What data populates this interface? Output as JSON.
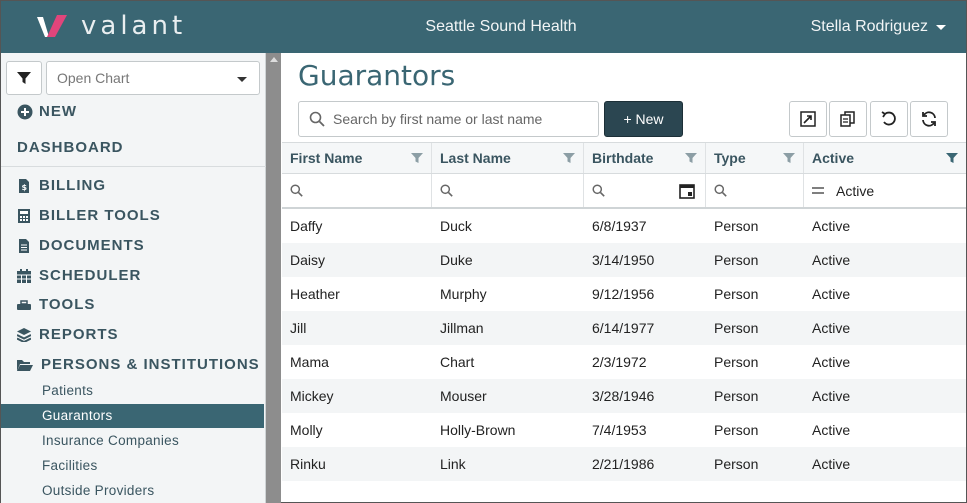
{
  "app": {
    "logo_text": "valant",
    "title": "Seattle Sound Health",
    "user": "Stella Rodriguez"
  },
  "sidebar": {
    "open_chart_placeholder": "Open Chart",
    "new_label": "NEW",
    "dashboard_label": "DASHBOARD",
    "items": [
      {
        "label": "BILLING",
        "icon": "file-dollar-icon"
      },
      {
        "label": "BILLER TOOLS",
        "icon": "calculator-icon"
      },
      {
        "label": "DOCUMENTS",
        "icon": "document-icon"
      },
      {
        "label": "SCHEDULER",
        "icon": "calendar-icon"
      },
      {
        "label": "TOOLS",
        "icon": "wrench-icon"
      },
      {
        "label": "REPORTS",
        "icon": "layers-icon"
      },
      {
        "label": "PERSONS & INSTITUTIONS",
        "icon": "folder-open-icon"
      }
    ],
    "sub_items": [
      {
        "label": "Patients",
        "active": false
      },
      {
        "label": "Guarantors",
        "active": true
      },
      {
        "label": "Insurance Companies",
        "active": false
      },
      {
        "label": "Facilities",
        "active": false
      },
      {
        "label": "Outside Providers",
        "active": false
      }
    ]
  },
  "main": {
    "title": "Guarantors",
    "search_placeholder": "Search by first name or last name",
    "new_button": "+ New",
    "columns": [
      "First Name",
      "Last Name",
      "Birthdate",
      "Type",
      "Active"
    ],
    "active_filter_value": "Active",
    "rows": [
      [
        "Daffy",
        "Duck",
        "6/8/1937",
        "Person",
        "Active"
      ],
      [
        "Daisy",
        "Duke",
        "3/14/1950",
        "Person",
        "Active"
      ],
      [
        "Heather",
        "Murphy",
        "9/12/1956",
        "Person",
        "Active"
      ],
      [
        "Jill",
        "Jillman",
        "6/14/1977",
        "Person",
        "Active"
      ],
      [
        "Mama",
        "Chart",
        "2/3/1972",
        "Person",
        "Active"
      ],
      [
        "Mickey",
        "Mouser",
        "3/28/1946",
        "Person",
        "Active"
      ],
      [
        "Molly",
        "Holly-Brown",
        "7/4/1953",
        "Person",
        "Active"
      ],
      [
        "Rinku",
        "Link",
        "2/21/1986",
        "Person",
        "Active"
      ]
    ]
  },
  "colors": {
    "header": "#3a6673",
    "accent_pink": "#e0457b",
    "nav_text": "#3a5560",
    "new_button": "#2b4651"
  }
}
